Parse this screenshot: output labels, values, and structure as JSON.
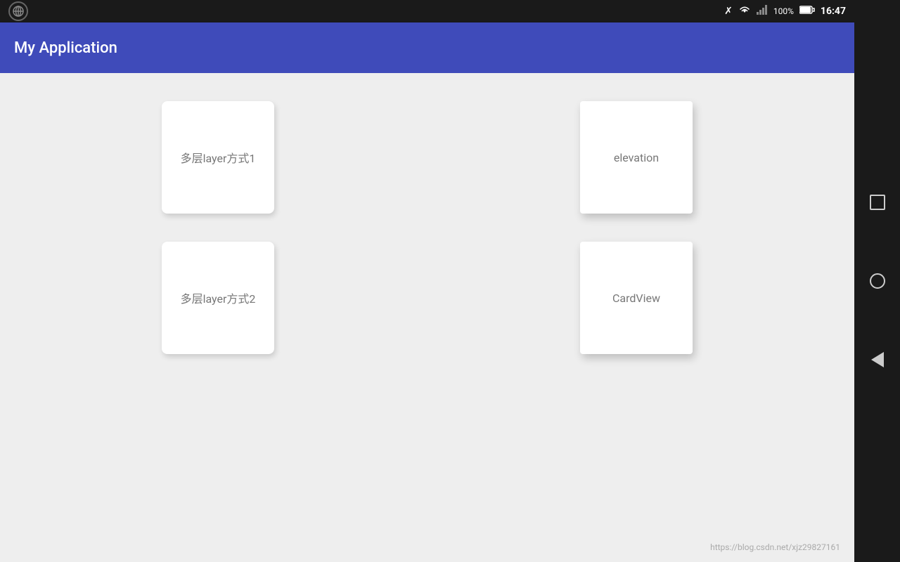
{
  "statusBar": {
    "time": "16:47",
    "battery": "100%",
    "icons": {
      "bluetooth": "bluetooth-icon",
      "wifi": "wifi-icon",
      "signal": "signal-icon",
      "battery": "battery-icon"
    }
  },
  "appBar": {
    "title": "My Application"
  },
  "cards": [
    {
      "id": "card-1",
      "label": "多层layer方式1",
      "position": "top-left"
    },
    {
      "id": "card-2",
      "label": "elevation",
      "position": "top-right"
    },
    {
      "id": "card-3",
      "label": "多层layer方式2",
      "position": "bottom-left"
    },
    {
      "id": "card-4",
      "label": "CardView",
      "position": "bottom-right"
    }
  ],
  "footer": {
    "url": "https://blog.csdn.net/xjz29827161"
  },
  "navBar": {
    "buttons": [
      {
        "id": "square-btn",
        "shape": "square"
      },
      {
        "id": "circle-btn",
        "shape": "circle"
      },
      {
        "id": "back-btn",
        "shape": "triangle"
      }
    ]
  }
}
